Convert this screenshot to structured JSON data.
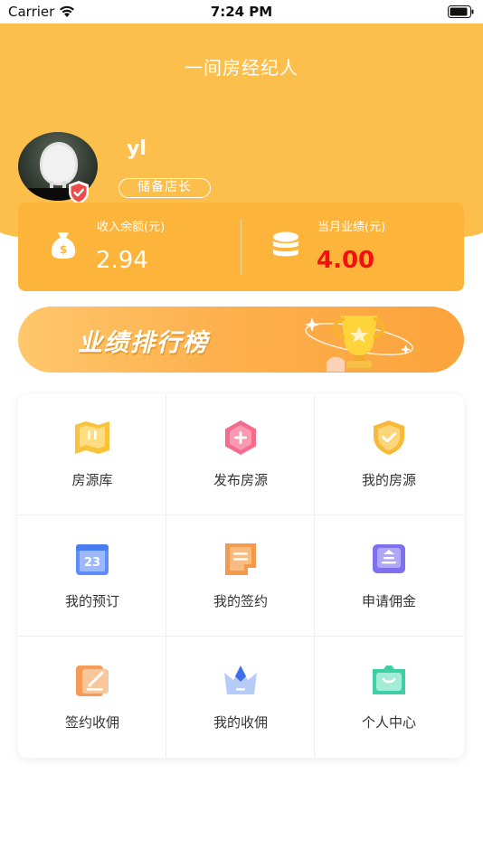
{
  "status_bar": {
    "carrier": "Carrier",
    "time": "7:24 PM"
  },
  "header": {
    "title": "一间房经纪人"
  },
  "profile": {
    "username": "yl",
    "role": "储备店长"
  },
  "stats": {
    "balance_label": "收入余额(元)",
    "balance_value": "2.94",
    "monthly_label": "当月业绩(元)",
    "monthly_value": "4.00"
  },
  "banner": {
    "ranking_label": "业绩排行榜"
  },
  "menu": [
    {
      "label": "房源库",
      "icon": "house-library-icon"
    },
    {
      "label": "发布房源",
      "icon": "publish-plus-icon"
    },
    {
      "label": "我的房源",
      "icon": "my-listing-shield-icon"
    },
    {
      "label": "我的预订",
      "icon": "calendar-icon"
    },
    {
      "label": "我的签约",
      "icon": "contract-icon"
    },
    {
      "label": "申请佣金",
      "icon": "commission-apply-icon"
    },
    {
      "label": "签约收佣",
      "icon": "sign-commission-icon"
    },
    {
      "label": "我的收佣",
      "icon": "crown-icon"
    },
    {
      "label": "个人中心",
      "icon": "personal-center-icon"
    }
  ],
  "colors": {
    "header": "#FDBF4C",
    "card": "#FDB43A",
    "highlight": "#F10F0F"
  }
}
